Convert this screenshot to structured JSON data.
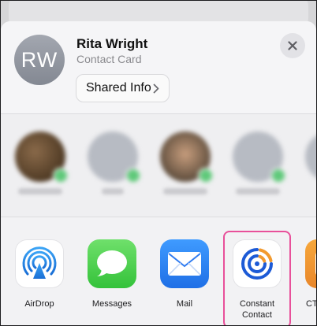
{
  "contact": {
    "initials": "RW",
    "name": "Rita Wright",
    "subtitle": "Contact Card",
    "shared_info_label": "Shared Info"
  },
  "icons": {
    "close": "close-icon",
    "chevron": "chevron-right-icon"
  },
  "apps": [
    {
      "label": "AirDrop",
      "icon": "airdrop-icon"
    },
    {
      "label": "Messages",
      "icon": "messages-icon"
    },
    {
      "label": "Mail",
      "icon": "mail-icon"
    },
    {
      "label": "Constant\nContact",
      "icon": "constant-contact-icon"
    },
    {
      "label": "CT",
      "icon": "ct-app-icon"
    }
  ],
  "colors": {
    "highlight": "#e8509a",
    "messages_green": "#5cd05a",
    "mail_blue": "#2f7bf0",
    "constant_contact_blue": "#1c5ad6",
    "constant_contact_orange": "#f29a2e"
  }
}
